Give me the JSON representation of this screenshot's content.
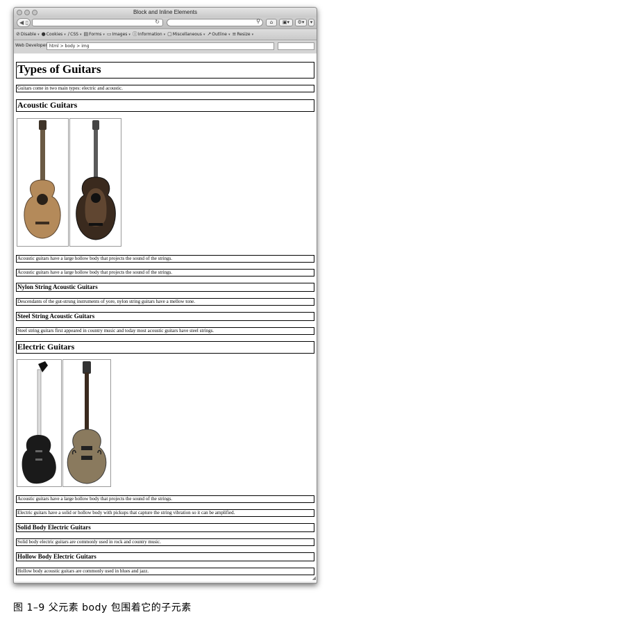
{
  "window": {
    "title": "Block and Inline Elements"
  },
  "navbar": {
    "back_forward_icon": "back-forward-icon",
    "reload_icon": "reload-icon",
    "search_icon": "search-icon"
  },
  "toolbar": {
    "items": [
      {
        "icon": "⊘",
        "label": "Disable"
      },
      {
        "icon": "●",
        "label": "Cookies"
      },
      {
        "icon": "∕",
        "label": "CSS"
      },
      {
        "icon": "▤",
        "label": "Forms"
      },
      {
        "icon": "▭",
        "label": "Images"
      },
      {
        "icon": "ⓘ",
        "label": "Information"
      },
      {
        "icon": "▢",
        "label": "Miscellaneous"
      },
      {
        "icon": "↗",
        "label": "Outline"
      },
      {
        "icon": "≡",
        "label": "Resize"
      }
    ]
  },
  "pathbar": {
    "label": "Web Developer",
    "path": "html > body > img"
  },
  "page": {
    "h1": "Types of Guitars",
    "intro": "Guitars come in two main types: electric and acoustic.",
    "acoustic_heading": "Acoustic Guitars",
    "acoustic_p1": "Acoustic guitars have a large hollow body that projects the sound of the strings.",
    "acoustic_p2": "Acoustic guitars have a large hollow body that projects the sound of the strings.",
    "nylon_heading": "Nylon String Acoustic Guitars",
    "nylon_p": "Descendants of the gut-strung instruments of yore, nylon string guitars have a mellow tone.",
    "steel_heading": "Steel String Acoustic Guitars",
    "steel_p": "Steel string guitars first appeared in country music and today most acoustic guitars have steel strings.",
    "electric_heading": "Electric Guitars",
    "electric_p1": "Acoustic guitars have a large hollow body that projects the sound of the strings.",
    "electric_p2": "Electric guitars have a solid or hollow body with pickups that capture the string vibration so it can be amplified.",
    "solid_heading": "Solid Body Electric Guitars",
    "solid_p": "Solid body electric guitars are commonly used in rock and country music.",
    "hollow_heading": "Hollow Body Electric Guitars",
    "hollow_p": "Hollow body acoustic guitars are commonly used in blues and jazz."
  },
  "caption": "图 1–9   父元素 body 包围着它的子元素",
  "colors": {
    "chrome": "#d4d4d4",
    "border": "#000000",
    "image_border": "#999999"
  }
}
